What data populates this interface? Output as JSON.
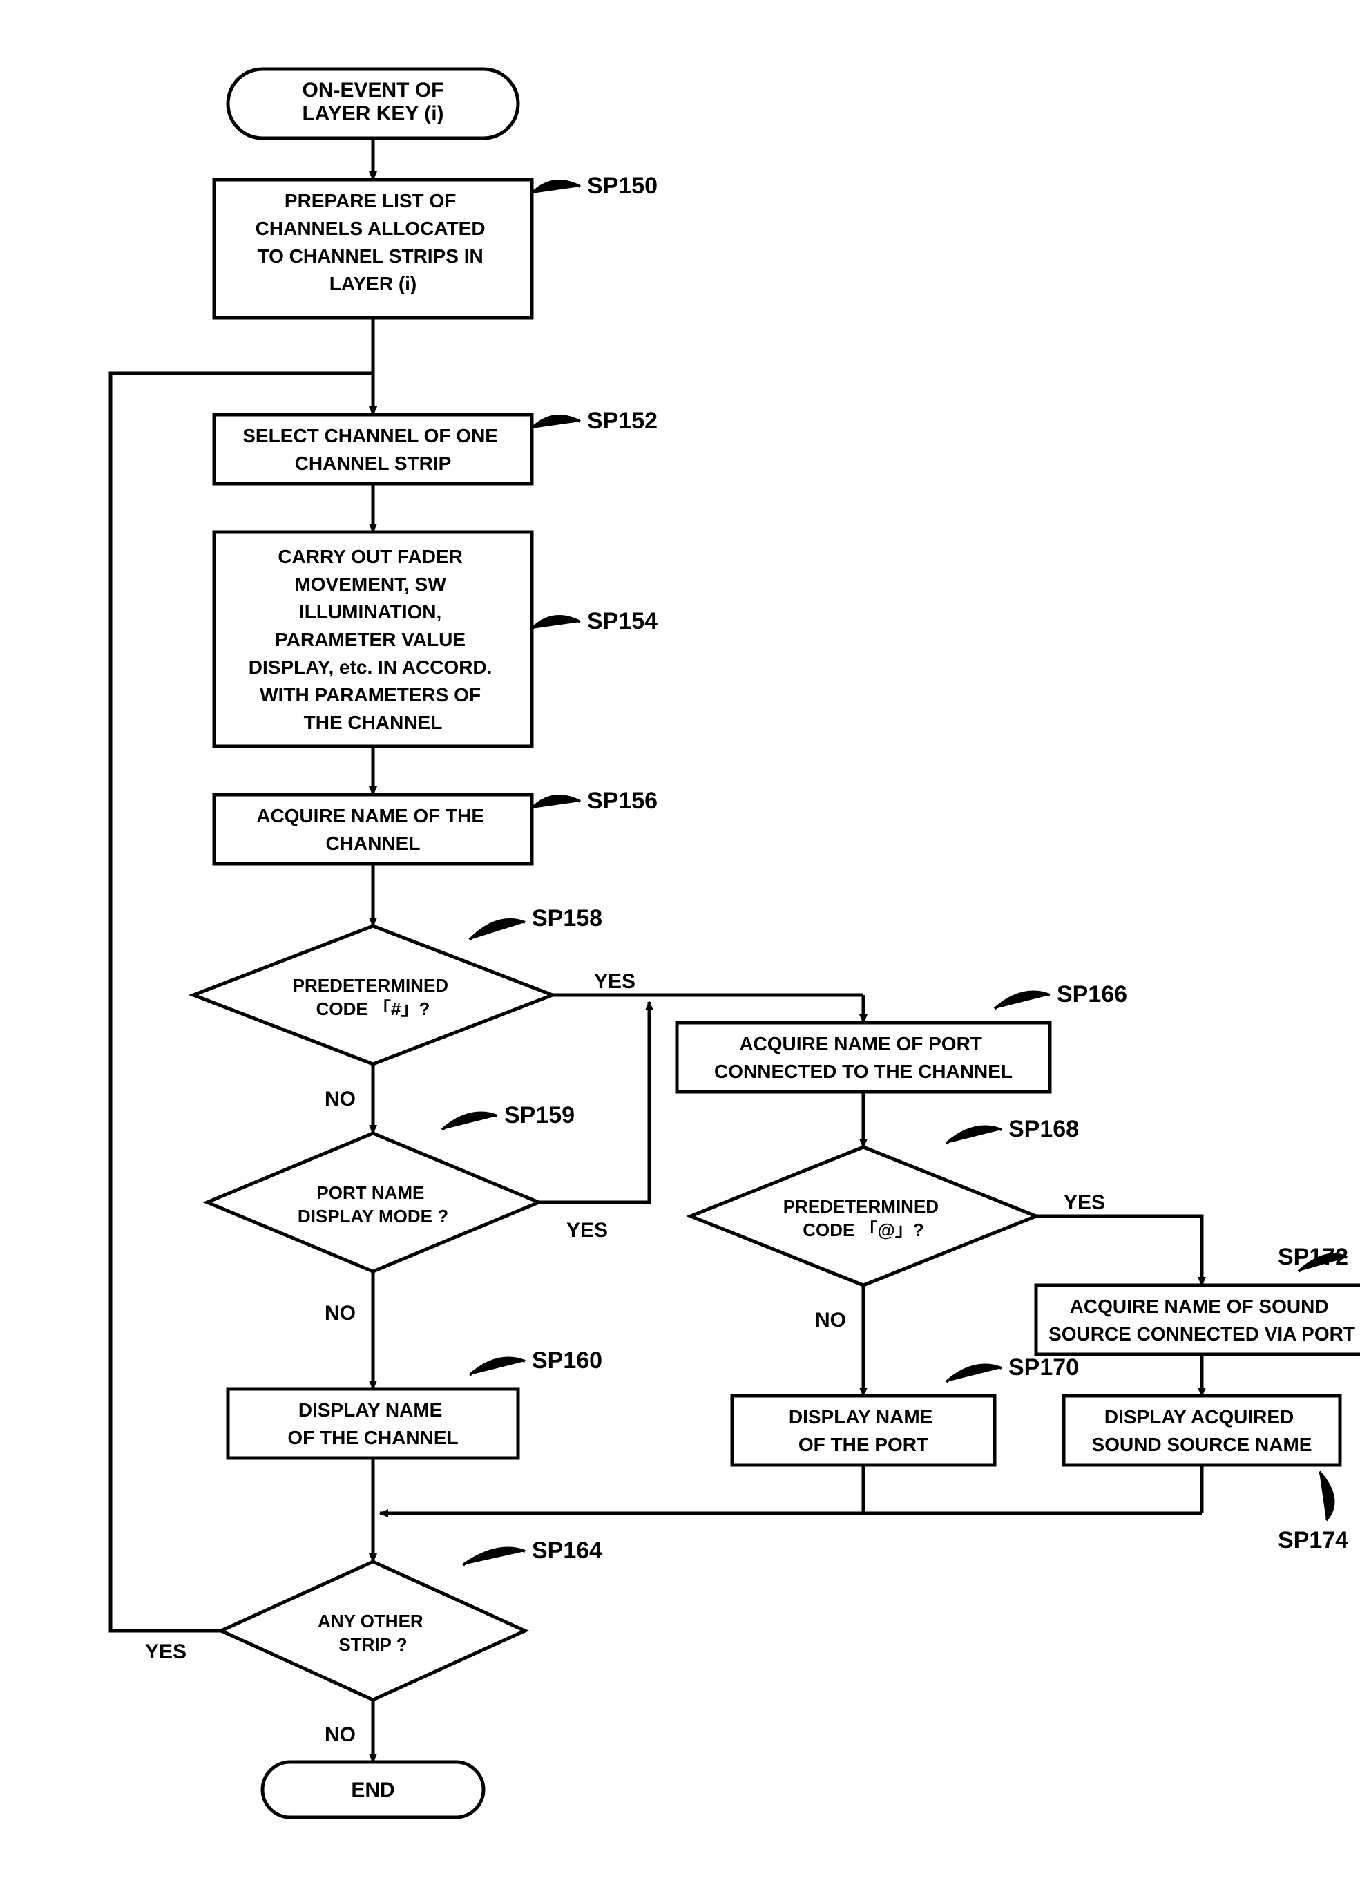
{
  "chart_data": {
    "type": "flowchart",
    "nodes": [
      {
        "id": "start",
        "kind": "terminal",
        "text": "ON-EVENT OF\nLAYER KEY (i)"
      },
      {
        "id": "sp150",
        "kind": "process",
        "label": "SP150",
        "text": "PREPARE LIST OF\nCHANNELS ALLOCATED\nTO CHANNEL STRIPS IN\nLAYER (i)"
      },
      {
        "id": "sp152",
        "kind": "process",
        "label": "SP152",
        "text": "SELECT CHANNEL OF ONE\nCHANNEL STRIP"
      },
      {
        "id": "sp154",
        "kind": "process",
        "label": "SP154",
        "text": "CARRY OUT FADER\nMOVEMENT, SW\nILLUMINATION,\nPARAMETER VALUE\nDISPLAY, etc. IN ACCORD.\nWITH PARAMETERS OF\nTHE CHANNEL"
      },
      {
        "id": "sp156",
        "kind": "process",
        "label": "SP156",
        "text": "ACQUIRE NAME OF THE\nCHANNEL"
      },
      {
        "id": "sp158",
        "kind": "decision",
        "label": "SP158",
        "text": "PREDETERMINED\nCODE 「#」?"
      },
      {
        "id": "sp159",
        "kind": "decision",
        "label": "SP159",
        "text": "PORT NAME\nDISPLAY MODE ?"
      },
      {
        "id": "sp160",
        "kind": "process",
        "label": "SP160",
        "text": "DISPLAY NAME\nOF THE CHANNEL"
      },
      {
        "id": "sp164",
        "kind": "decision",
        "label": "SP164",
        "text": "ANY OTHER\nSTRIP ?"
      },
      {
        "id": "sp166",
        "kind": "process",
        "label": "SP166",
        "text": "ACQUIRE NAME OF PORT\nCONNECTED TO THE CHANNEL"
      },
      {
        "id": "sp168",
        "kind": "decision",
        "label": "SP168",
        "text": "PREDETERMINED\nCODE 「@」?"
      },
      {
        "id": "sp170",
        "kind": "process",
        "label": "SP170",
        "text": "DISPLAY NAME\nOF THE PORT"
      },
      {
        "id": "sp172",
        "kind": "process",
        "label": "SP172",
        "text": "ACQUIRE NAME OF SOUND\nSOURCE CONNECTED VIA PORT"
      },
      {
        "id": "sp174",
        "kind": "process",
        "label": "SP174",
        "text": "DISPLAY ACQUIRED\nSOUND SOURCE NAME"
      },
      {
        "id": "end",
        "kind": "terminal",
        "text": "END"
      }
    ],
    "edges": [
      {
        "from": "start",
        "to": "sp150"
      },
      {
        "from": "sp150",
        "to": "sp152"
      },
      {
        "from": "sp152",
        "to": "sp154"
      },
      {
        "from": "sp154",
        "to": "sp156"
      },
      {
        "from": "sp156",
        "to": "sp158"
      },
      {
        "from": "sp158",
        "to": "sp166",
        "label": "YES"
      },
      {
        "from": "sp158",
        "to": "sp159",
        "label": "NO"
      },
      {
        "from": "sp159",
        "to": "sp158",
        "label": "YES"
      },
      {
        "from": "sp159",
        "to": "sp160",
        "label": "NO"
      },
      {
        "from": "sp160",
        "to": "sp164"
      },
      {
        "from": "sp166",
        "to": "sp168"
      },
      {
        "from": "sp168",
        "to": "sp172",
        "label": "YES"
      },
      {
        "from": "sp168",
        "to": "sp170",
        "label": "NO"
      },
      {
        "from": "sp170",
        "to": "sp164"
      },
      {
        "from": "sp172",
        "to": "sp174"
      },
      {
        "from": "sp174",
        "to": "sp164"
      },
      {
        "from": "sp164",
        "to": "sp152",
        "label": "YES"
      },
      {
        "from": "sp164",
        "to": "end",
        "label": "NO"
      }
    ]
  },
  "edge_labels": {
    "yes": "YES",
    "no": "NO"
  }
}
